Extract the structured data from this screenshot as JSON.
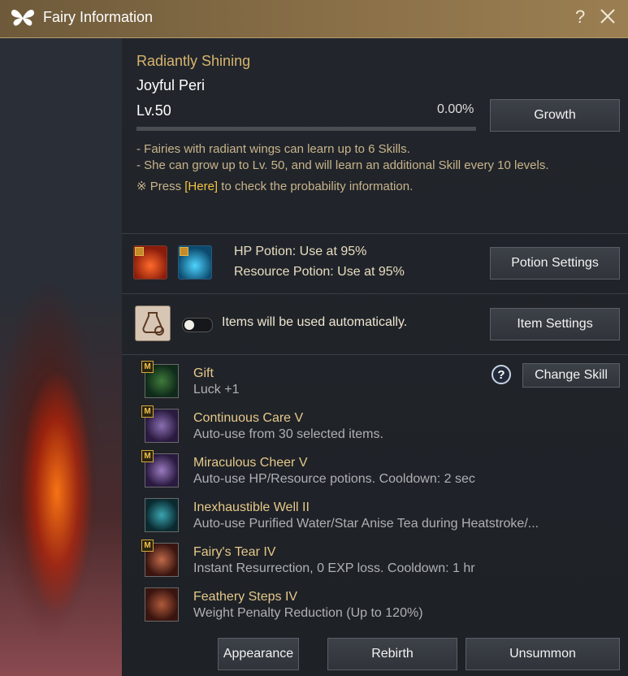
{
  "window": {
    "title": "Fairy Information",
    "help": "?"
  },
  "fairy": {
    "grade": "Radiantly Shining",
    "name": "Joyful Peri",
    "level_label": "Lv.",
    "level": "50",
    "progress_text": "0.00%",
    "progress": 0.0,
    "growth_button": "Growth"
  },
  "notes": {
    "line1": "- Fairies with radiant wings can learn up to 6 Skills.",
    "line2": "- She can grow up to Lv. 50, and will learn an additional Skill every 10 levels.",
    "line3_prefix": "※ Press ",
    "line3_link": "[Here]",
    "line3_suffix": " to check the probability information."
  },
  "potions": {
    "hp": "HP Potion: Use at 95%",
    "resource": "Resource Potion: Use at 95%",
    "settings_button": "Potion Settings"
  },
  "items": {
    "auto_text": "Items will be used automatically.",
    "toggle_on": false,
    "settings_button": "Item Settings"
  },
  "skills_header": {
    "help": "?",
    "change_button": "Change Skill"
  },
  "skills": [
    {
      "badge": "M",
      "name": "Gift",
      "desc": "Luck +1",
      "icon": "clover-icon"
    },
    {
      "badge": "M",
      "name": "Continuous Care V",
      "desc": "Auto-use from 30 selected items.",
      "icon": "fairy-icon"
    },
    {
      "badge": "M",
      "name": "Miraculous Cheer V",
      "desc": "Auto-use HP/Resource potions. Cooldown: 2 sec",
      "icon": "potion-icon"
    },
    {
      "badge": "",
      "name": "Inexhaustible Well II",
      "desc": "Auto-use Purified Water/Star Anise Tea during Heatstroke/...",
      "icon": "well-icon"
    },
    {
      "badge": "M",
      "name": "Fairy's Tear IV",
      "desc": "Instant Resurrection, 0 EXP loss. Cooldown: 1 hr",
      "icon": "tear-icon"
    },
    {
      "badge": "",
      "name": "Feathery Steps IV",
      "desc": "Weight Penalty Reduction (Up to 120%)",
      "icon": "weight-icon"
    }
  ],
  "footer": {
    "appearance": "Appearance",
    "rebirth": "Rebirth",
    "unsummon": "Unsummon"
  }
}
